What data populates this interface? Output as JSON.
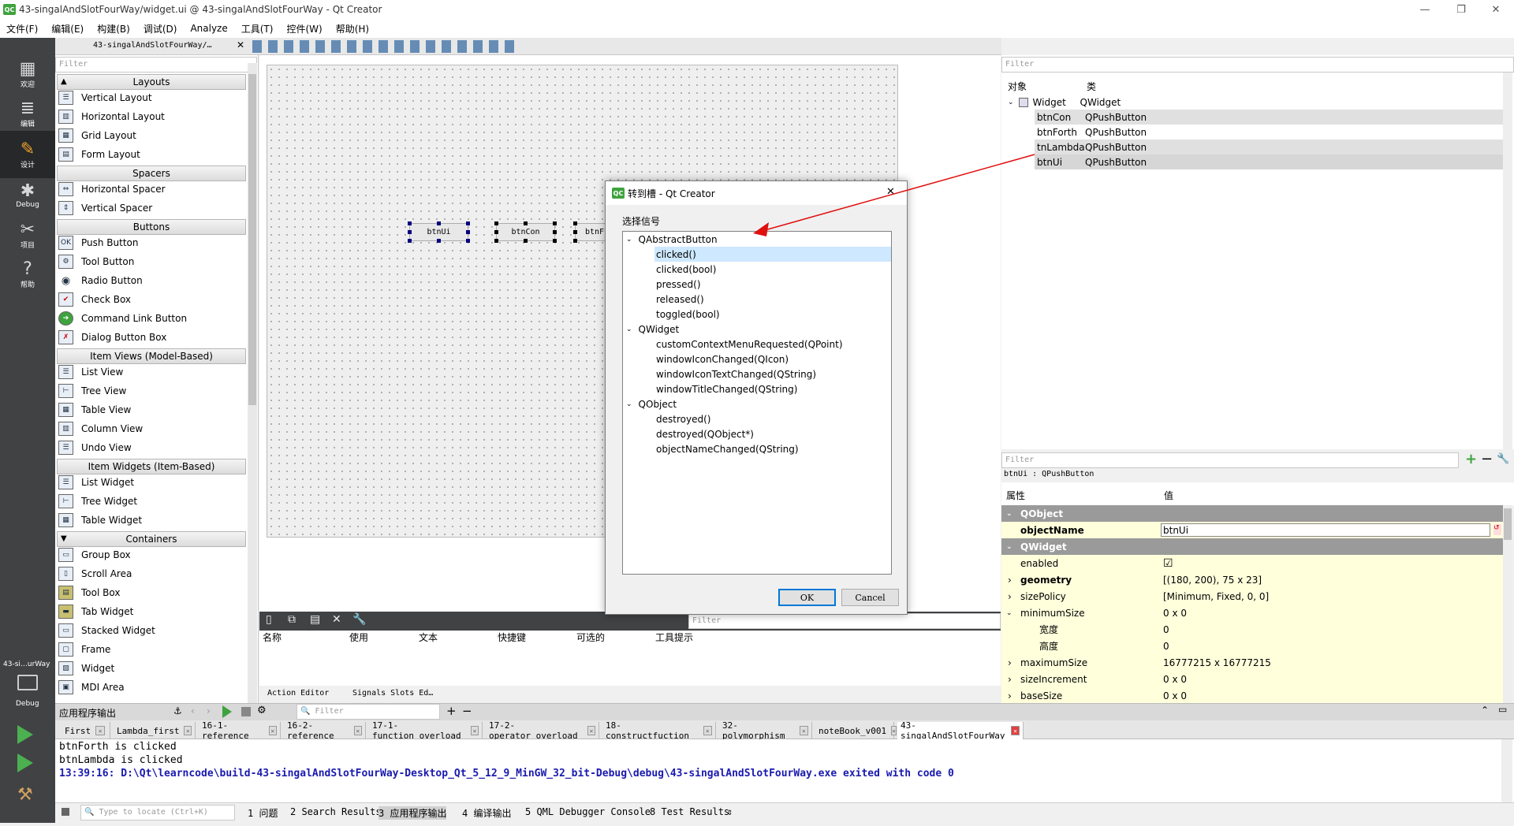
{
  "window": {
    "title": "43-singalAndSlotFourWay/widget.ui @ 43-singalAndSlotFourWay - Qt Creator",
    "minimize": "—",
    "maximize": "❐",
    "close": "✕"
  },
  "menu": [
    "文件(F)",
    "编辑(E)",
    "构建(B)",
    "调试(D)",
    "Analyze",
    "工具(T)",
    "控件(W)",
    "帮助(H)"
  ],
  "modes": [
    {
      "label": "欢迎",
      "icon": "▦"
    },
    {
      "label": "编辑",
      "icon": "≣"
    },
    {
      "label": "设计",
      "icon": "✎"
    },
    {
      "label": "Debug",
      "icon": "✱"
    },
    {
      "label": "项目",
      "icon": "✂"
    },
    {
      "label": "帮助",
      "icon": "?"
    }
  ],
  "kit": {
    "project": "43-si…urWay",
    "mode": "Debug"
  },
  "editor_toolbar": {
    "file": "43-singalAndSlotFourWay/…"
  },
  "widgetbox": {
    "filter_placeholder": "Filter",
    "categories": {
      "layouts": "Layouts",
      "spacers": "Spacers",
      "buttons": "Buttons",
      "item_views": "Item Views (Model-Based)",
      "item_widgets": "Item Widgets (Item-Based)",
      "containers": "Containers"
    },
    "layouts": [
      "Vertical Layout",
      "Horizontal Layout",
      "Grid Layout",
      "Form Layout"
    ],
    "spacers": [
      "Horizontal Spacer",
      "Vertical Spacer"
    ],
    "buttons": [
      "Push Button",
      "Tool Button",
      "Radio Button",
      "Check Box",
      "Command Link Button",
      "Dialog Button Box"
    ],
    "item_views": [
      "List View",
      "Tree View",
      "Table View",
      "Column View",
      "Undo View"
    ],
    "item_widgets": [
      "List Widget",
      "Tree Widget",
      "Table Widget"
    ],
    "containers": [
      "Group Box",
      "Scroll Area",
      "Tool Box",
      "Tab Widget",
      "Stacked Widget",
      "Frame",
      "Widget",
      "MDI Area"
    ]
  },
  "form": {
    "buttons": [
      "btnUi",
      "btnCon",
      "btnF"
    ]
  },
  "action_editor": {
    "filter_placeholder": "Filter",
    "columns": [
      "名称",
      "使用",
      "文本",
      "快捷键",
      "可选的",
      "工具提示"
    ],
    "tabs": [
      "Action Editor",
      "Signals  Slots Ed…"
    ]
  },
  "object_inspector": {
    "filter_placeholder": "Filter",
    "col_object": "对象",
    "col_class": "类",
    "root": {
      "name": "Widget",
      "class": "QWidget"
    },
    "children": [
      {
        "name": "btnCon",
        "class": "QPushButton"
      },
      {
        "name": "btnForth",
        "class": "QPushButton"
      },
      {
        "name": "tnLambda",
        "class": "QPushButton"
      },
      {
        "name": "btnUi",
        "class": "QPushButton"
      }
    ]
  },
  "property_editor": {
    "filter_placeholder": "Filter",
    "current": "btnUi : QPushButton",
    "col_prop": "属性",
    "col_value": "值",
    "section_qobject": "QObject",
    "section_qwidget": "QWidget",
    "rows": [
      {
        "name": "objectName",
        "value": "btnUi"
      },
      {
        "name": "enabled",
        "value": "☑"
      },
      {
        "name": "geometry",
        "value": "[(180, 200), 75 x 23]"
      },
      {
        "name": "sizePolicy",
        "value": "[Minimum, Fixed, 0, 0]"
      },
      {
        "name": "minimumSize",
        "value": "0 x 0"
      },
      {
        "name": "宽度",
        "value": "0"
      },
      {
        "name": "高度",
        "value": "0"
      },
      {
        "name": "maximumSize",
        "value": "16777215 x 16777215"
      },
      {
        "name": "sizeIncrement",
        "value": "0 x 0"
      },
      {
        "name": "baseSize",
        "value": "0 x 0"
      }
    ]
  },
  "dialog": {
    "title": "转到槽 - Qt Creator",
    "label": "选择信号",
    "groups": [
      {
        "name": "QAbstractButton",
        "signals": [
          "clicked()",
          "clicked(bool)",
          "pressed()",
          "released()",
          "toggled(bool)"
        ]
      },
      {
        "name": "QWidget",
        "signals": [
          "customContextMenuRequested(QPoint)",
          "windowIconChanged(QIcon)",
          "windowIconTextChanged(QString)",
          "windowTitleChanged(QString)"
        ]
      },
      {
        "name": "QObject",
        "signals": [
          "destroyed()",
          "destroyed(QObject*)",
          "objectNameChanged(QString)"
        ]
      }
    ],
    "ok": "OK",
    "cancel": "Cancel"
  },
  "output": {
    "title": "应用程序输出",
    "filter_placeholder": "Filter",
    "tabs": [
      "First",
      "Lambda_first",
      "16-1-reference",
      "16-2-reference",
      "17-1-function_overload",
      "17-2-operator_overload",
      "18-constructfuction",
      "32-polymorphism",
      "noteBook_v001",
      "43-singalAndSlotFourWay"
    ],
    "lines": [
      "btnForth is clicked",
      "btnLambda is clicked",
      "13:39:16: D:\\Qt\\learncode\\build-43-singalAndSlotFourWay-Desktop_Qt_5_12_9_MinGW_32_bit-Debug\\debug\\43-singalAndSlotFourWay.exe exited with code 0"
    ]
  },
  "statusbar": {
    "locate_placeholder": "Type to locate (Ctrl+K)",
    "panes": [
      "1 问题",
      "2 Search Results",
      "3 应用程序输出",
      "4 编译输出",
      "5 QML Debugger Console",
      "8 Test Results"
    ]
  },
  "colors": {
    "accent": "#3ea33e",
    "selection": "#cde8ff",
    "propYellow": "#ffffdc",
    "sectionGray": "#9a9a9a",
    "arrow": "#e01010",
    "logFinal": "#1a1ab0"
  }
}
